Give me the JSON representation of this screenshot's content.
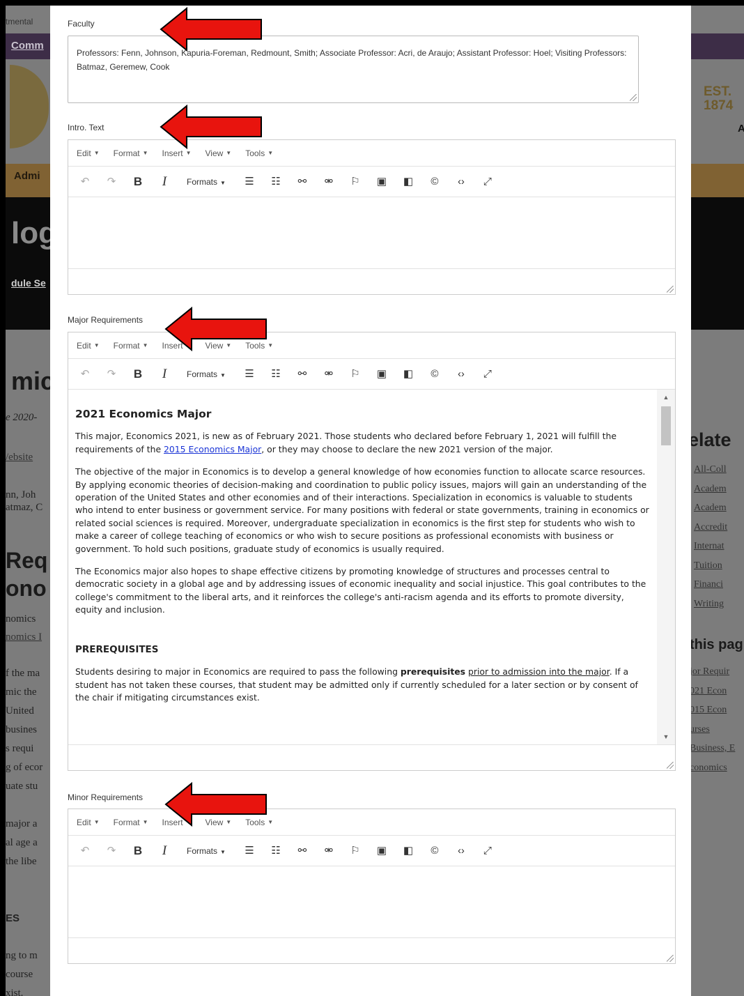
{
  "background_page": {
    "topbar_fragment": "tmental",
    "nav_fragment": "Comm",
    "established": "EST.",
    "established_year": "1874",
    "top_right_fragment": "A",
    "nav_admissions": "Admi",
    "page_title_fragment": "log",
    "schedule_fragment": "dule Se",
    "heading_fragment": "mic",
    "year_fragment": "e 2020-",
    "website_fragment": "/ebsite",
    "faculty_fragment_1": "nn, Joh",
    "faculty_fragment_2": "atmaz, C",
    "req_fragment_1": "Req",
    "req_fragment_2": "ono",
    "left_text_lines": [
      "nomics",
      "nomics I",
      "",
      "f the ma",
      "mic the",
      "United",
      "busines",
      "s requi",
      "g of ecor",
      "uate stu",
      "",
      "major a",
      "al age a",
      "the libe",
      "",
      "",
      "ES",
      "",
      "ng to m",
      "course",
      "xist."
    ],
    "related_heading": "elate",
    "related_links": [
      "All-Coll",
      "Academ",
      "Academ",
      "Accredit",
      "Internat",
      "Tuition",
      "Financi",
      "Writing"
    ],
    "on_this_page_heading": "this pag",
    "on_this_page_links": [
      "jor Requir",
      "021 Econ",
      "015 Econ",
      "urses",
      "Business, E",
      "conomics"
    ]
  },
  "faculty": {
    "label": "Faculty",
    "value": "Professors: Fenn, Johnson,  Kapuria-Foreman,  Redmount, Smith; Associate Professor: Acri, de Araujo; Assistant Professor:  Hoel; Visiting Professors: Batmaz, Geremew, Cook"
  },
  "editor_menus": [
    "Edit",
    "Format",
    "Insert",
    "View",
    "Tools"
  ],
  "formats_label": "Formats",
  "editors": {
    "intro": {
      "label": "Intro. Text"
    },
    "major": {
      "label": "Major Requirements"
    },
    "minor": {
      "label": "Minor Requirements"
    }
  },
  "major_doc": {
    "heading": "2021 Economics Major",
    "p1_a": "This major, Economics 2021, is new as of February 2021.  Those students who declared before February 1, 2021 will fulfill the requirements of the ",
    "p1_link": "2015 Economics Major",
    "p1_b": ", or they may choose to declare the new 2021 version of the major.",
    "p2": "The objective of the major in Economics is to develop a general knowledge of how economies function to allocate scarce resources.  By applying economic theories of decision-making and coordination to public policy issues, majors will gain an understanding of the operation of the United States and other economies and of their interactions.  Specialization in economics is valuable to students who intend to enter business or government service.  For many positions with federal or state governments, training in economics or related social sciences is required.  Moreover, undergraduate specialization in economics is the first step for students who wish to make a career of college teaching of economics or who wish to secure positions as professional economists with business or government.  To hold such positions, graduate study of economics is usually required.",
    "p3": "The Economics major also hopes to shape effective citizens by promoting knowledge of structures and processes central to democratic society in a global age and by addressing issues of economic inequality and social injustice. This goal contributes to the college's commitment to the liberal arts, and it reinforces the college's anti-racism agenda and its efforts to promote diversity, equity and inclusion.",
    "prereq_heading": "PREREQUISITES",
    "p4_a": "Students desiring to major in Economics are required to pass the following ",
    "p4_bold": "prerequisites",
    "p4_b": " ",
    "p4_u": "prior to admission into the major",
    "p4_c": ".  If a student has not taken these courses, that student may be admitted only if currently scheduled for a later section or by consent of the chair if mitigating circumstances exist."
  },
  "colors": {
    "arrow": "#e8140e",
    "link": "#1a34d6",
    "purple_bar": "#3d2d47",
    "gold_bar": "#806233"
  }
}
